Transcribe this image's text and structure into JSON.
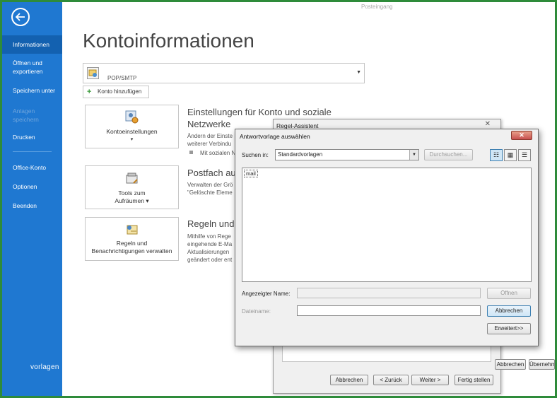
{
  "window": {
    "title": "Posteingang"
  },
  "sidebar": {
    "items": [
      {
        "label": "Informationen"
      },
      {
        "label": "Öffnen und exportieren"
      },
      {
        "label": "Speichern unter"
      },
      {
        "label": "Anlagen speichern"
      },
      {
        "label": "Drucken"
      },
      {
        "label": "Office-Konto"
      },
      {
        "label": "Optionen"
      },
      {
        "label": "Beenden"
      }
    ],
    "watermark": "vorlagen"
  },
  "main": {
    "title": "Kontoinformationen",
    "account_type": "POP/SMTP",
    "add_account": "Konto hinzufügen",
    "tiles": [
      {
        "label": "Kontoeinstellungen",
        "icon": "account-settings-icon"
      },
      {
        "label": "Tools zum Aufräumen",
        "icon": "cleanup-tools-icon"
      },
      {
        "label": "Regeln und Benachrichtigungen verwalten",
        "icon": "rules-alerts-icon"
      }
    ],
    "sections": [
      {
        "title_line1": "Einstellungen für Konto und soziale",
        "title_line2": "Netzwerke",
        "text_line1": "Ändern der Einste",
        "text_line2": "weiterer Verbindu",
        "bullet": "Mit sozialen N"
      },
      {
        "title": "Postfach au",
        "text_line1": "Verwalten der Grö",
        "text_line2": "\"Gelöschte Eleme"
      },
      {
        "title": "Regeln und",
        "text_line1": "Mithilfe von Rege",
        "text_line2": "eingehende E-Ma",
        "text_line3": "Aktualisierungen",
        "text_line4": "geändert oder ent"
      }
    ]
  },
  "rule_wizard": {
    "title": "Regel-Assistent",
    "buttons": {
      "cancel": "Abbrechen",
      "back": "< Zurück",
      "next": "Weiter >",
      "finish": "Fertig stellen",
      "side_cancel": "Abbrechen",
      "side_apply": "Übernehm"
    }
  },
  "template_dialog": {
    "title": "Antwortvorlage auswählen",
    "search_label": "Suchen in:",
    "folder_value": "Standardvorlagen",
    "browse_button": "Durchsuchen...",
    "files": [
      "mail"
    ],
    "display_name_label": "Angezeigter Name:",
    "file_name_label": "Dateiname:",
    "open_button": "Öffnen",
    "cancel_button": "Abbrechen",
    "advanced_button": "Erweitert>>"
  },
  "colors": {
    "sidebar": "#1f78d1",
    "frame": "#2e8b3a",
    "close": "#c75050"
  }
}
